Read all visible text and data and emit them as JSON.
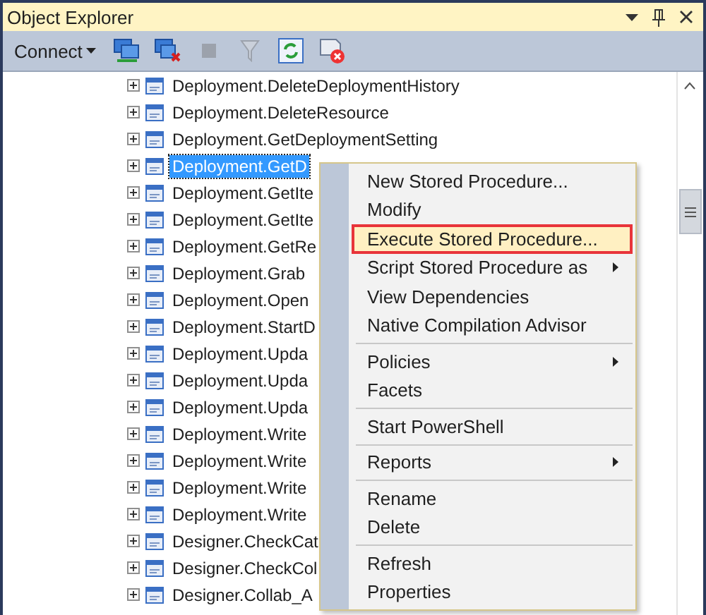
{
  "window": {
    "title": "Object Explorer"
  },
  "toolbar": {
    "connect": "Connect",
    "tools": [
      {
        "kind": "connect",
        "disabled": false
      },
      {
        "kind": "disconnect",
        "disabled": false
      },
      {
        "kind": "stop",
        "disabled": true
      },
      {
        "kind": "filter",
        "disabled": true
      },
      {
        "kind": "refresh",
        "disabled": false
      },
      {
        "kind": "stop-activity",
        "disabled": false
      }
    ]
  },
  "tree": {
    "items": [
      {
        "label": "Deployment.DeleteDeploymentHistory",
        "selected": false
      },
      {
        "label": "Deployment.DeleteResource",
        "selected": false
      },
      {
        "label": "Deployment.GetDeploymentSetting",
        "selected": false
      },
      {
        "label": "Deployment.GetD",
        "selected": true
      },
      {
        "label": "Deployment.GetIte",
        "selected": false
      },
      {
        "label": "Deployment.GetIte",
        "selected": false
      },
      {
        "label": "Deployment.GetRe",
        "selected": false
      },
      {
        "label": "Deployment.Grab",
        "selected": false
      },
      {
        "label": "Deployment.Open",
        "selected": false
      },
      {
        "label": "Deployment.StartD",
        "selected": false
      },
      {
        "label": "Deployment.Upda",
        "selected": false
      },
      {
        "label": "Deployment.Upda",
        "selected": false
      },
      {
        "label": "Deployment.Upda",
        "selected": false
      },
      {
        "label": "Deployment.Write",
        "selected": false
      },
      {
        "label": "Deployment.Write",
        "selected": false
      },
      {
        "label": "Deployment.Write",
        "selected": false
      },
      {
        "label": "Deployment.Write",
        "selected": false
      },
      {
        "label": "Designer.CheckCat",
        "selected": false
      },
      {
        "label": "Designer.CheckCol",
        "selected": false
      },
      {
        "label": "Designer.Collab_A",
        "selected": false
      }
    ]
  },
  "context_menu": {
    "items": [
      {
        "kind": "item",
        "label": "New Stored Procedure...",
        "submenu": false,
        "selected": false
      },
      {
        "kind": "item",
        "label": "Modify",
        "submenu": false,
        "selected": false
      },
      {
        "kind": "item",
        "label": "Execute Stored Procedure...",
        "submenu": false,
        "selected": true
      },
      {
        "kind": "item",
        "label": "Script Stored Procedure as",
        "submenu": true,
        "selected": false
      },
      {
        "kind": "item",
        "label": "View Dependencies",
        "submenu": false,
        "selected": false
      },
      {
        "kind": "item",
        "label": "Native Compilation Advisor",
        "submenu": false,
        "selected": false
      },
      {
        "kind": "separator"
      },
      {
        "kind": "item",
        "label": "Policies",
        "submenu": true,
        "selected": false
      },
      {
        "kind": "item",
        "label": "Facets",
        "submenu": false,
        "selected": false
      },
      {
        "kind": "separator"
      },
      {
        "kind": "item",
        "label": "Start PowerShell",
        "submenu": false,
        "selected": false
      },
      {
        "kind": "separator"
      },
      {
        "kind": "item",
        "label": "Reports",
        "submenu": true,
        "selected": false
      },
      {
        "kind": "separator"
      },
      {
        "kind": "item",
        "label": "Rename",
        "submenu": false,
        "selected": false
      },
      {
        "kind": "item",
        "label": "Delete",
        "submenu": false,
        "selected": false
      },
      {
        "kind": "separator"
      },
      {
        "kind": "item",
        "label": "Refresh",
        "submenu": false,
        "selected": false
      },
      {
        "kind": "item",
        "label": "Properties",
        "submenu": false,
        "selected": false
      }
    ]
  }
}
